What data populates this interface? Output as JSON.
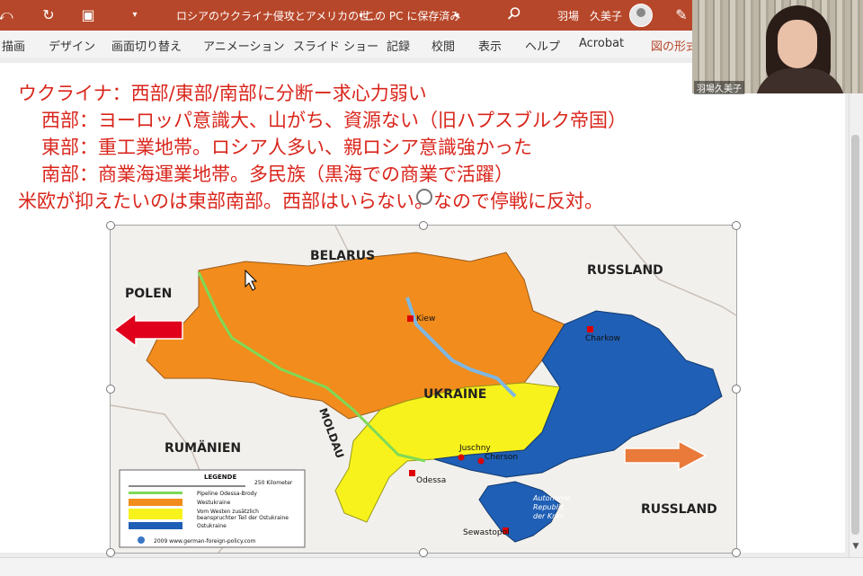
{
  "titlebar": {
    "doc_title": "ロシアのウクライナ侵攻とアメリカの世...",
    "save_state": "•この PC に保存済み",
    "user_name": "羽場　久美子"
  },
  "ribbon": {
    "tabs": [
      "描画",
      "デザイン",
      "画面切り替え",
      "アニメーション",
      "スライド ショー",
      "記録",
      "校閲",
      "表示",
      "ヘルプ",
      "Acrobat",
      "図の形式"
    ]
  },
  "video": {
    "participant_name": "羽場久美子"
  },
  "slide": {
    "notes": [
      "ウクライナ：西部/東部/南部に分断ー求心力弱い",
      "西部：ヨーロッパ意識大、山がち、資源ない（旧ハプスブルク帝国）",
      "東部：重工業地帯。ロシア人多い、親ロシア意識強かった",
      "南部：商業海運業地帯。多民族（黒海での商業で活躍）",
      "米欧が抑えたいのは東部南部。西部はいらない。なので停戦に反対。"
    ],
    "map": {
      "countries": {
        "belarus": "BELARUS",
        "polen": "POLEN",
        "russland_north": "RUSSLAND",
        "russland_south": "RUSSLAND",
        "ukraine": "UKRAINE",
        "moldau": "MOLDAU",
        "rumaenien": "RUMÄNIEN"
      },
      "cities": {
        "kiew": "Kiew",
        "charkow": "Charkow",
        "juschny": "Juschny",
        "cherson": "Cherson",
        "odessa": "Odessa",
        "sewastopol": "Sewastopol"
      },
      "crimea_label": [
        "Autonome",
        "Republik",
        "der Krim"
      ],
      "colors": {
        "west": "#f28c1c",
        "south": "#f7f21c",
        "east": "#1f5fb5",
        "pipeline": "#7ed957",
        "arrow_west": "#e0001b",
        "arrow_east": "#e97a3a"
      },
      "legend": {
        "title": "LEGENDE",
        "scale": "250 Kilometer",
        "items": [
          "Pipeline Odessa-Brody",
          "Westukraine",
          "Vom Westen zusätzlich",
          "beanspruchter Teil der Ostukraine",
          "Ostukraine"
        ],
        "source": "2009 www.german-foreign-policy.com"
      }
    }
  }
}
